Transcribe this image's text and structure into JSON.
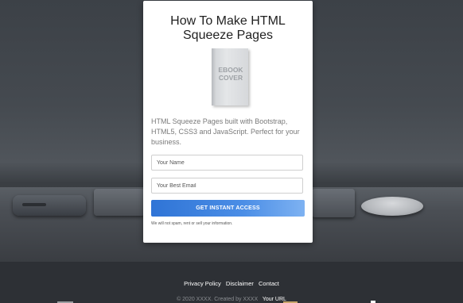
{
  "card": {
    "title": "How To Make HTML\nSqueeze Pages",
    "ebook_text": "EBOOK\nCOVER",
    "description": "HTML Squeeze Pages built with Bootstrap, HTML5, CSS3 and JavaScript. Perfect for your business.",
    "name_placeholder": "Your Name",
    "email_placeholder": "Your Best Email",
    "cta_label": "GET INSTANT ACCESS",
    "note": "We will not spam, rent or sell your information."
  },
  "footer": {
    "links": [
      "Privacy Policy",
      "Disclaimer",
      "Contact"
    ],
    "copyright": "© 2020 XXXX. Created by XXXX",
    "your_url": "Your URL"
  }
}
